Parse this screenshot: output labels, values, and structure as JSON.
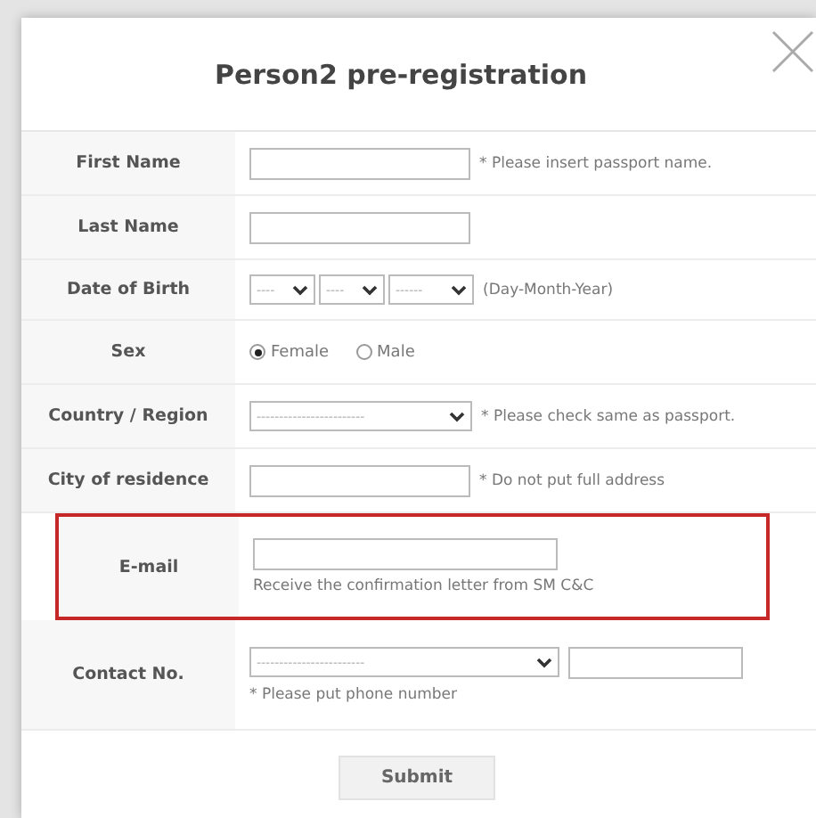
{
  "dialog": {
    "title": "Person2 pre-registration"
  },
  "rows": [
    {
      "kind": "text",
      "label": "First Name",
      "note": "* Please insert passport name.",
      "highlighted": false
    },
    {
      "kind": "text",
      "label": "Last Name",
      "highlighted": false
    },
    {
      "kind": "date",
      "label": "Date of Birth",
      "selects": [
        "----",
        "----",
        "------"
      ],
      "note": "(Day-Month-Year)",
      "highlighted": false
    },
    {
      "kind": "radio",
      "label": "Sex",
      "options": [
        {
          "label": "Female",
          "selected": true
        },
        {
          "label": "Male",
          "selected": false
        }
      ],
      "highlighted": false
    },
    {
      "kind": "select",
      "label": "Country / Region",
      "select": "------------------------",
      "note": "* Please check same as passport.",
      "highlighted": false
    },
    {
      "kind": "text",
      "label": "City of residence",
      "note": "* Do not put full address",
      "highlighted": false
    },
    {
      "kind": "email",
      "label": "E-mail",
      "note": "Receive the confirmation letter from SM C&C",
      "highlighted": true
    },
    {
      "kind": "contact",
      "label": "Contact No.",
      "select": "------------------------",
      "note": "* Please put phone number",
      "highlighted": false
    }
  ],
  "submit": "Submit"
}
